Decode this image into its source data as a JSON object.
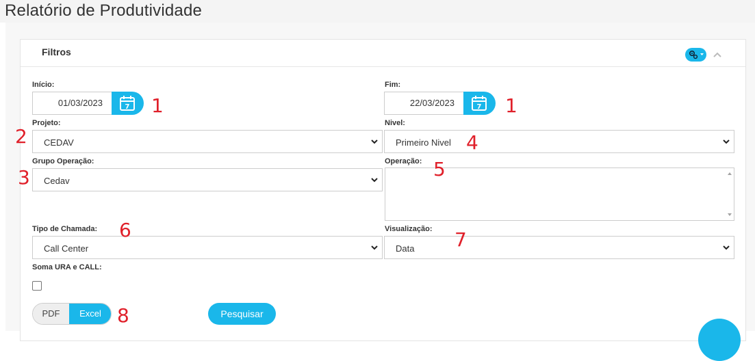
{
  "page": {
    "title": "Relatório de Produtividade"
  },
  "panel": {
    "title": "Filtros"
  },
  "filters": {
    "inicio": {
      "label": "Início:",
      "value": "01/03/2023"
    },
    "fim": {
      "label": "Fim:",
      "value": "22/03/2023"
    },
    "projeto": {
      "label": "Projeto:",
      "value": "CEDAV"
    },
    "nivel": {
      "label": "Nivel:",
      "value": "Primeiro Nivel"
    },
    "grupo_operacao": {
      "label": "Grupo Operação:",
      "value": "Cedav"
    },
    "operacao": {
      "label": "Operação:"
    },
    "tipo_chamada": {
      "label": "Tipo de Chamada:",
      "value": "Call Center"
    },
    "visualizacao": {
      "label": "Visualização:",
      "value": "Data"
    },
    "soma": {
      "label": "Soma URA e CALL:",
      "checked": false
    }
  },
  "actions": {
    "pdf": "PDF",
    "excel": "Excel",
    "search": "Pesquisar"
  },
  "annotations": {
    "a1": "1",
    "a1b": "1",
    "a2": "2",
    "a3": "3",
    "a4": "4",
    "a5": "5",
    "a6": "6",
    "a7": "7",
    "a8": "8"
  },
  "icons": {
    "calendar": "calendar-icon",
    "chevron": "chevron-down-icon",
    "tools": "gears-icon",
    "collapse": "chevron-up-icon"
  },
  "colors": {
    "accent": "#1ab7ea",
    "annotation": "#e0202a"
  }
}
